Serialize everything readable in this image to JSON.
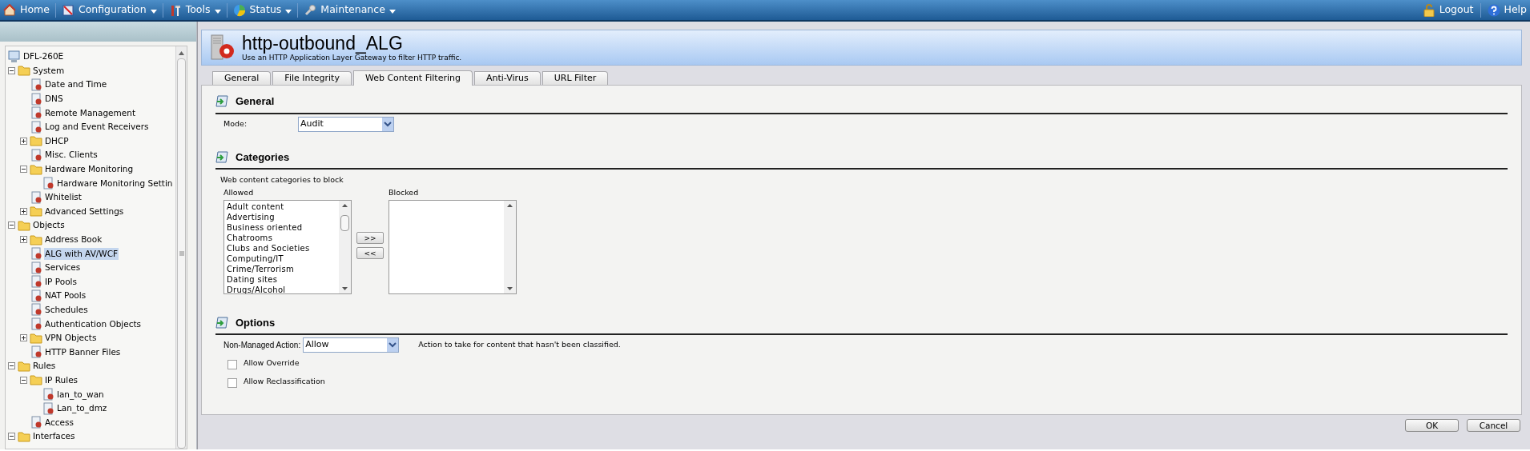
{
  "nav": {
    "left": [
      {
        "label": "Home",
        "dropdown": false
      },
      {
        "label": "Configuration",
        "dropdown": true
      },
      {
        "label": "Tools",
        "dropdown": true
      },
      {
        "label": "Status",
        "dropdown": true
      },
      {
        "label": "Maintenance",
        "dropdown": true
      }
    ],
    "right": [
      {
        "label": "Logout"
      },
      {
        "label": "Help"
      }
    ]
  },
  "tree": {
    "label": "DFL-260E",
    "selected": false,
    "children": [
      {
        "label": "System",
        "expanded": true,
        "selected": false,
        "children": [
          {
            "label": "Date and Time",
            "selected": false
          },
          {
            "label": "DNS",
            "selected": false
          },
          {
            "label": "Remote Management",
            "selected": false
          },
          {
            "label": "Log and Event Receivers",
            "selected": false
          },
          {
            "label": "DHCP",
            "expanded": false,
            "selected": false
          },
          {
            "label": "Misc. Clients",
            "selected": false
          },
          {
            "label": "Hardware Monitoring",
            "expanded": true,
            "selected": false,
            "children": [
              {
                "label": "Hardware Monitoring Settin",
                "selected": false
              }
            ]
          },
          {
            "label": "Whitelist",
            "selected": false
          },
          {
            "label": "Advanced Settings",
            "expanded": false,
            "selected": false
          }
        ]
      },
      {
        "label": "Objects",
        "expanded": true,
        "selected": false,
        "children": [
          {
            "label": "Address Book",
            "expanded": false,
            "selected": false
          },
          {
            "label": "ALG with AV/WCF",
            "selected": true
          },
          {
            "label": "Services",
            "selected": false
          },
          {
            "label": "IP Pools",
            "selected": false
          },
          {
            "label": "NAT Pools",
            "selected": false
          },
          {
            "label": "Schedules",
            "selected": false
          },
          {
            "label": "Authentication Objects",
            "selected": false
          },
          {
            "label": "VPN Objects",
            "expanded": false,
            "selected": false
          },
          {
            "label": "HTTP Banner Files",
            "selected": false
          }
        ]
      },
      {
        "label": "Rules",
        "expanded": true,
        "selected": false,
        "children": [
          {
            "label": "IP Rules",
            "expanded": true,
            "selected": false,
            "children": [
              {
                "label": "lan_to_wan",
                "selected": false
              },
              {
                "label": "Lan_to_dmz",
                "selected": false
              }
            ]
          },
          {
            "label": "Access",
            "selected": false
          }
        ]
      },
      {
        "label": "Interfaces",
        "expanded": true,
        "selected": false
      }
    ]
  },
  "header": {
    "title": "http-outbound_ALG",
    "subtitle": "Use an HTTP Application Layer Gateway to filter HTTP traffic."
  },
  "tabs": [
    {
      "label": "General",
      "selected": false
    },
    {
      "label": "File Integrity",
      "selected": false
    },
    {
      "label": "Web Content Filtering",
      "selected": true
    },
    {
      "label": "Anti-Virus",
      "selected": false
    },
    {
      "label": "URL Filter",
      "selected": false
    }
  ],
  "general": {
    "title": "General",
    "mode_label": "Mode:",
    "mode_value": "Audit"
  },
  "categories": {
    "title": "Categories",
    "hint": "Web content categories to block",
    "allowed_label": "Allowed",
    "allowed": [
      "Adult content",
      "Advertising",
      "Business oriented",
      "Chatrooms",
      "Clubs and Societies",
      "Computing/IT",
      "Crime/Terrorism",
      "Dating sites",
      "Drugs/Alcohol"
    ],
    "add_button": ">>",
    "remove_button": "<<",
    "blocked_label": "Blocked"
  },
  "options": {
    "title": "Options",
    "action_label": "Non-Managed Action:",
    "action_value": "Allow",
    "action_help": "Action to take for content that hasn't been classified.",
    "checkboxes": [
      {
        "label": "Allow Override",
        "checked": false
      },
      {
        "label": "Allow Reclassification",
        "checked": false
      }
    ]
  },
  "buttons": [
    "OK",
    "Cancel"
  ]
}
